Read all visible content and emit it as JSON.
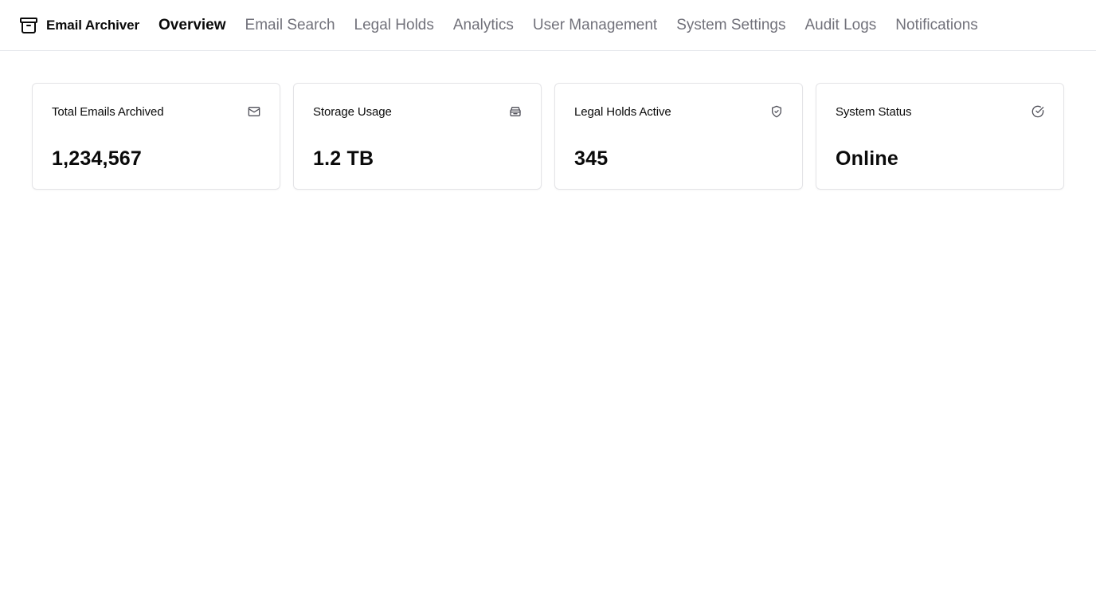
{
  "app": {
    "name": "Email Archiver",
    "logo_icon": "archive-icon"
  },
  "nav": {
    "items": [
      {
        "label": "Overview",
        "active": true
      },
      {
        "label": "Email Search",
        "active": false
      },
      {
        "label": "Legal Holds",
        "active": false
      },
      {
        "label": "Analytics",
        "active": false
      },
      {
        "label": "User Management",
        "active": false
      },
      {
        "label": "System Settings",
        "active": false
      },
      {
        "label": "Audit Logs",
        "active": false
      },
      {
        "label": "Notifications",
        "active": false
      }
    ]
  },
  "stats": [
    {
      "title": "Total Emails Archived",
      "value": "1,234,567",
      "icon": "mail-icon"
    },
    {
      "title": "Storage Usage",
      "value": "1.2 TB",
      "icon": "storage-icon"
    },
    {
      "title": "Legal Holds Active",
      "value": "345",
      "icon": "shield-check-icon"
    },
    {
      "title": "System Status",
      "value": "Online",
      "icon": "circle-check-icon"
    }
  ],
  "colors": {
    "text_primary": "#0a0a0a",
    "text_muted": "#71717a",
    "border": "#e4e4e7",
    "icon": "#52525b"
  }
}
